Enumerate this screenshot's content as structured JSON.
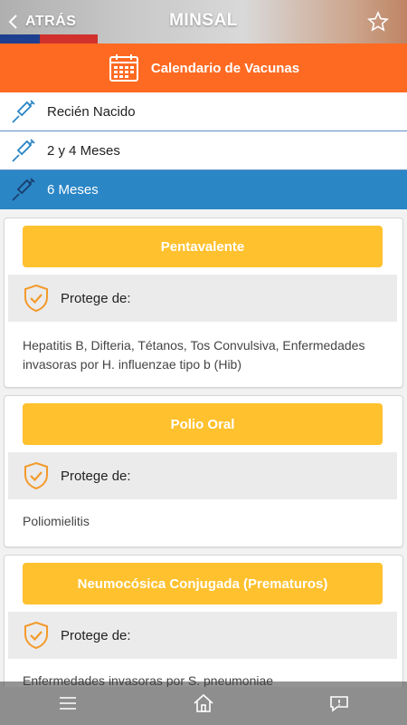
{
  "header": {
    "back_label": "ATRÁS",
    "title": "MINSAL",
    "icons": {
      "back": "chevron-left-icon",
      "favorite": "star-outline-icon"
    }
  },
  "banner": {
    "label": "Calendario de Vacunas",
    "icon": "calendar-icon",
    "color": "#ff6a22"
  },
  "ages": [
    {
      "label": "Recién Nacido",
      "icon": "syringe-icon",
      "active": false
    },
    {
      "label": "2 y 4 Meses",
      "icon": "syringe-icon",
      "active": false
    },
    {
      "label": "6 Meses",
      "icon": "syringe-icon",
      "active": true
    }
  ],
  "vaccines": [
    {
      "name": "Pentavalente",
      "protects_label": "Protege de:",
      "diseases": "Hepatitis B, Difteria, Tétanos, Tos Convulsiva, Enfermedades invasoras por H. influenzae tipo b (Hib)"
    },
    {
      "name": "Polio Oral",
      "protects_label": "Protege de:",
      "diseases": "Poliomielitis"
    },
    {
      "name": "Neumocósica Conjugada (Prematuros)",
      "protects_label": "Protege de:",
      "diseases": "Enfermedades invasoras por S. pneumoniae"
    }
  ],
  "bottom_nav": {
    "icons": [
      "menu-icon",
      "home-icon",
      "chat-icon"
    ]
  },
  "colors": {
    "accent_orange": "#ff6a22",
    "active_blue": "#2b86c6",
    "vaccine_yellow": "#ffc12e",
    "shield_orange": "#f39a2b"
  }
}
